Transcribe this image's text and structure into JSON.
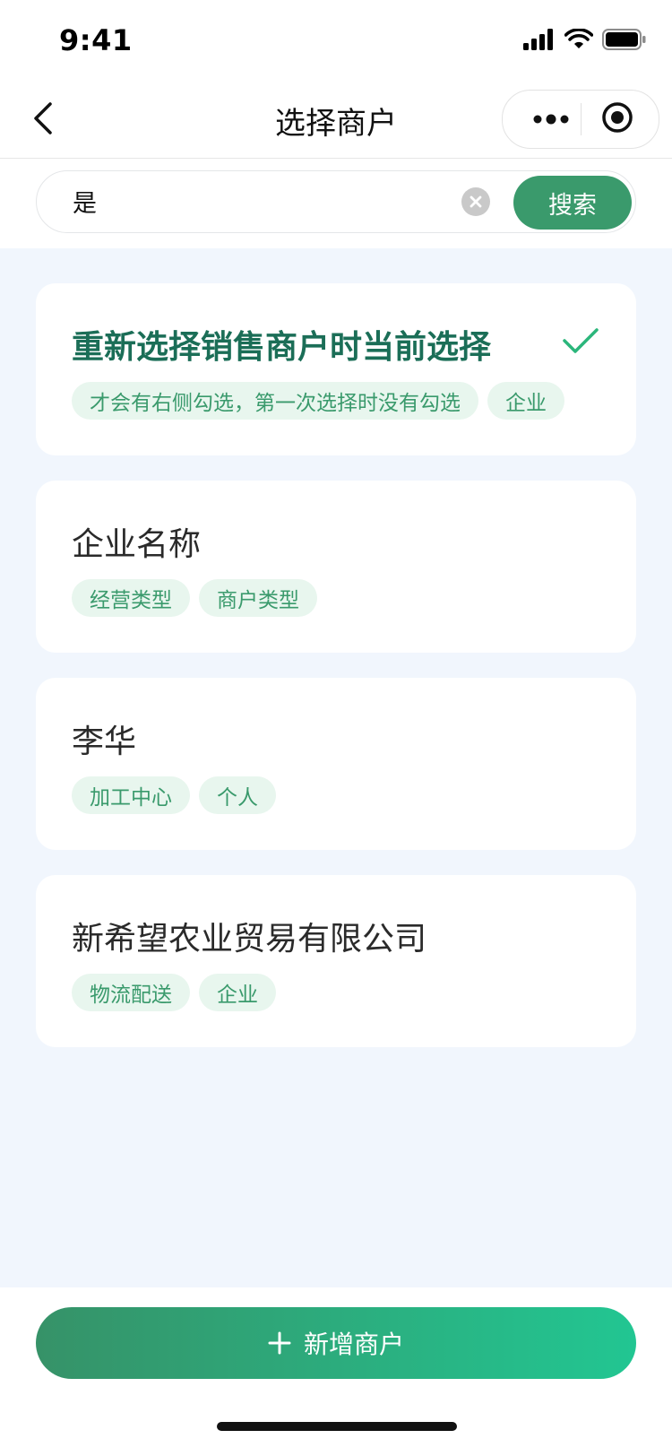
{
  "status_bar": {
    "time": "9:41"
  },
  "nav": {
    "title": "选择商户"
  },
  "search": {
    "value": "是",
    "button_label": "搜索"
  },
  "merchants": [
    {
      "name": "重新选择销售商户时当前选择",
      "tags": [
        "才会有右侧勾选，第一次选择时没有勾选",
        "企业"
      ],
      "selected": true
    },
    {
      "name": "企业名称",
      "tags": [
        "经营类型",
        "商户类型"
      ],
      "selected": false
    },
    {
      "name": "李华",
      "tags": [
        "加工中心",
        "个人"
      ],
      "selected": false
    },
    {
      "name": "新希望农业贸易有限公司",
      "tags": [
        "物流配送",
        "企业"
      ],
      "selected": false
    }
  ],
  "footer": {
    "add_label": "新增商户"
  },
  "colors": {
    "accent": "#3a9a6c",
    "selected_title": "#1b6e57",
    "tag_bg": "#e8f6ee",
    "page_bg": "#f1f6fd"
  }
}
